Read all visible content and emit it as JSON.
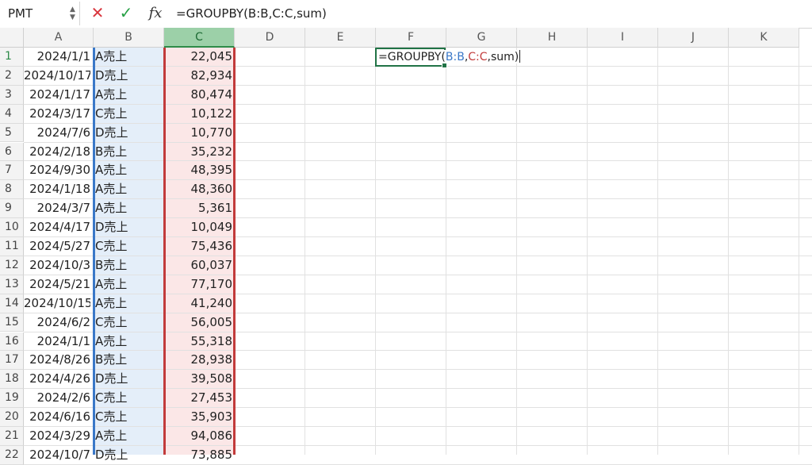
{
  "formula_bar": {
    "name_box": "PMT",
    "formula": "=GROUPBY(B:B,C:C,sum)",
    "cancel_icon": "close-icon",
    "enter_icon": "check-icon",
    "fx_label": "fx"
  },
  "sheet": {
    "columns": [
      "A",
      "B",
      "C",
      "D",
      "E",
      "F",
      "G",
      "H",
      "I",
      "J",
      "K"
    ],
    "selected_column": "C",
    "active_cell": "F1",
    "active_cell_formula": {
      "prefix": "=GROUPBY(",
      "ref1": "B:B",
      "sep1": ",",
      "ref2": "C:C",
      "suffix": ",sum)"
    },
    "colors": {
      "ref1": "#3a78c8",
      "ref2": "#c23b3b",
      "active": "#217346"
    },
    "rows": [
      {
        "n": "1",
        "date": "2024/1/1",
        "cat": "A売上",
        "amount": "22,045"
      },
      {
        "n": "2",
        "date": "2024/10/17",
        "cat": "D売上",
        "amount": "82,934"
      },
      {
        "n": "3",
        "date": "2024/1/17",
        "cat": "A売上",
        "amount": "80,474"
      },
      {
        "n": "4",
        "date": "2024/3/17",
        "cat": "C売上",
        "amount": "10,122"
      },
      {
        "n": "5",
        "date": "2024/7/6",
        "cat": "D売上",
        "amount": "10,770"
      },
      {
        "n": "6",
        "date": "2024/2/18",
        "cat": "B売上",
        "amount": "35,232"
      },
      {
        "n": "7",
        "date": "2024/9/30",
        "cat": "A売上",
        "amount": "48,395"
      },
      {
        "n": "8",
        "date": "2024/1/18",
        "cat": "A売上",
        "amount": "48,360"
      },
      {
        "n": "9",
        "date": "2024/3/7",
        "cat": "A売上",
        "amount": "5,361"
      },
      {
        "n": "10",
        "date": "2024/4/17",
        "cat": "D売上",
        "amount": "10,049"
      },
      {
        "n": "11",
        "date": "2024/5/27",
        "cat": "C売上",
        "amount": "75,436"
      },
      {
        "n": "12",
        "date": "2024/10/3",
        "cat": "B売上",
        "amount": "60,037"
      },
      {
        "n": "13",
        "date": "2024/5/21",
        "cat": "A売上",
        "amount": "77,170"
      },
      {
        "n": "14",
        "date": "2024/10/15",
        "cat": "A売上",
        "amount": "41,240"
      },
      {
        "n": "15",
        "date": "2024/6/2",
        "cat": "C売上",
        "amount": "56,005"
      },
      {
        "n": "16",
        "date": "2024/1/1",
        "cat": "A売上",
        "amount": "55,318"
      },
      {
        "n": "17",
        "date": "2024/8/26",
        "cat": "B売上",
        "amount": "28,938"
      },
      {
        "n": "18",
        "date": "2024/4/26",
        "cat": "D売上",
        "amount": "39,508"
      },
      {
        "n": "19",
        "date": "2024/2/6",
        "cat": "C売上",
        "amount": "27,453"
      },
      {
        "n": "20",
        "date": "2024/6/16",
        "cat": "C売上",
        "amount": "35,903"
      },
      {
        "n": "21",
        "date": "2024/3/29",
        "cat": "A売上",
        "amount": "94,086"
      },
      {
        "n": "22",
        "date": "2024/10/7",
        "cat": "D売上",
        "amount": "73,885"
      }
    ]
  }
}
